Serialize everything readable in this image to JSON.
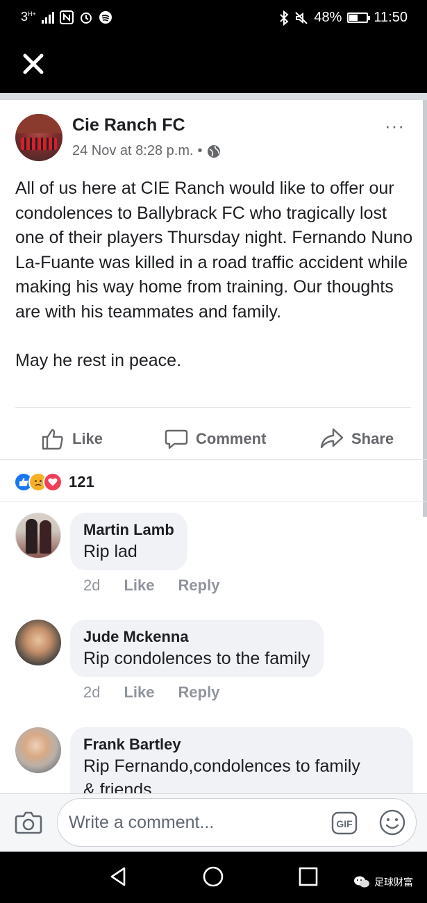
{
  "status_bar": {
    "network": "3",
    "network_sub": "H+",
    "battery_percent": "48%",
    "battery_level": 0.48,
    "time": "11:50",
    "icons": [
      "nfc-icon",
      "alarm-icon",
      "spotify-icon",
      "bluetooth-icon",
      "mute-icon",
      "battery-icon"
    ]
  },
  "app_bar": {
    "close_icon": "close-icon"
  },
  "post": {
    "page_name": "Cie Ranch FC",
    "timestamp": "24 Nov at 8:28 p.m.",
    "separator": "•",
    "privacy_icon": "globe-icon",
    "more_label": "···",
    "body_p1": "All of us here at CIE Ranch would like to offer our condolences to Ballybrack FC who tragically lost one of their players Thursday night. Fernando Nuno La-Fuante was killed in a road traffic accident while making his way home from training. Our thoughts are with his teammates and family.",
    "body_p2": "May he rest in peace.",
    "actions": {
      "like": "Like",
      "comment": "Comment",
      "share": "Share"
    },
    "reactions": {
      "types": [
        "like",
        "sad",
        "love"
      ],
      "count": "121"
    }
  },
  "comments": [
    {
      "author": "Martin Lamb",
      "text": "Rip lad",
      "time": "2d",
      "like": "Like",
      "reply": "Reply"
    },
    {
      "author": "Jude Mckenna",
      "text": "Rip condolences to the family",
      "time": "2d",
      "like": "Like",
      "reply": "Reply"
    },
    {
      "author": "Frank Bartley",
      "text": "Rip Fernando,condolences to family",
      "text_cut": "& friends"
    }
  ],
  "composer": {
    "placeholder": "Write a comment...",
    "gif_label": "GIF"
  },
  "nav": {
    "watermark": "足球财富"
  },
  "colors": {
    "brand_blue": "#1877f2",
    "love_red": "#f33e58",
    "sad_yellow": "#f7b125",
    "bubble_gray": "#f0f2f5"
  }
}
